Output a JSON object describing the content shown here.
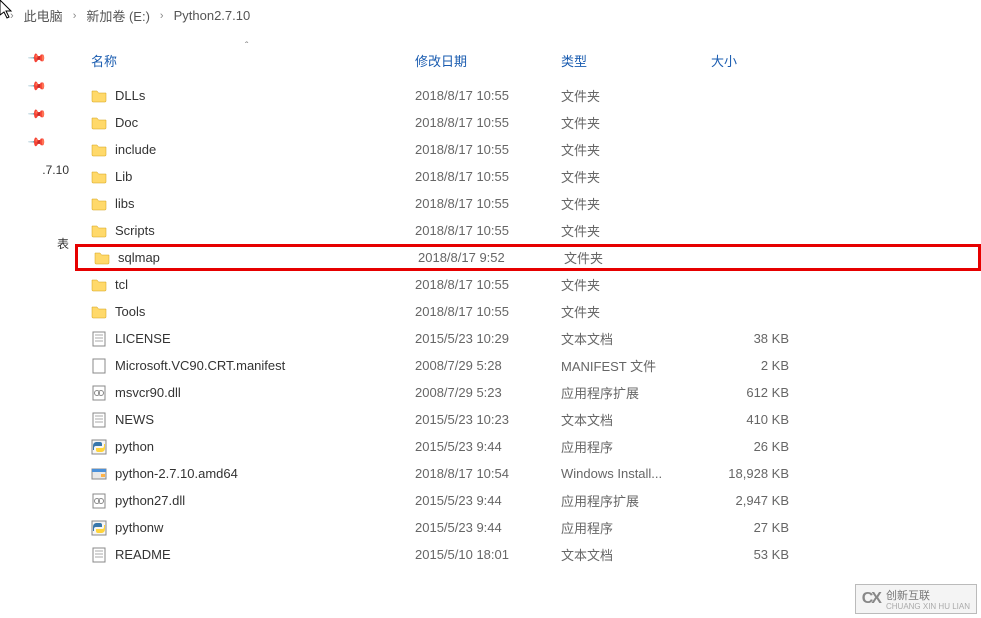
{
  "breadcrumb": {
    "items": [
      "此电脑",
      "新加卷 (E:)",
      "Python2.7.10"
    ]
  },
  "columns": {
    "name": "名称",
    "date": "修改日期",
    "type": "类型",
    "size": "大小"
  },
  "sidebar": {
    "truncated1": ".7.10",
    "truncated2": "表"
  },
  "files": [
    {
      "name": "DLLs",
      "date": "2018/8/17 10:55",
      "type": "文件夹",
      "size": "",
      "icon": "folder",
      "highlight": false
    },
    {
      "name": "Doc",
      "date": "2018/8/17 10:55",
      "type": "文件夹",
      "size": "",
      "icon": "folder",
      "highlight": false
    },
    {
      "name": "include",
      "date": "2018/8/17 10:55",
      "type": "文件夹",
      "size": "",
      "icon": "folder",
      "highlight": false
    },
    {
      "name": "Lib",
      "date": "2018/8/17 10:55",
      "type": "文件夹",
      "size": "",
      "icon": "folder",
      "highlight": false
    },
    {
      "name": "libs",
      "date": "2018/8/17 10:55",
      "type": "文件夹",
      "size": "",
      "icon": "folder",
      "highlight": false
    },
    {
      "name": "Scripts",
      "date": "2018/8/17 10:55",
      "type": "文件夹",
      "size": "",
      "icon": "folder",
      "highlight": false
    },
    {
      "name": "sqlmap",
      "date": "2018/8/17 9:52",
      "type": "文件夹",
      "size": "",
      "icon": "folder",
      "highlight": true
    },
    {
      "name": "tcl",
      "date": "2018/8/17 10:55",
      "type": "文件夹",
      "size": "",
      "icon": "folder",
      "highlight": false
    },
    {
      "name": "Tools",
      "date": "2018/8/17 10:55",
      "type": "文件夹",
      "size": "",
      "icon": "folder",
      "highlight": false
    },
    {
      "name": "LICENSE",
      "date": "2015/5/23 10:29",
      "type": "文本文档",
      "size": "38 KB",
      "icon": "text",
      "highlight": false
    },
    {
      "name": "Microsoft.VC90.CRT.manifest",
      "date": "2008/7/29 5:28",
      "type": "MANIFEST 文件",
      "size": "2 KB",
      "icon": "file",
      "highlight": false
    },
    {
      "name": "msvcr90.dll",
      "date": "2008/7/29 5:23",
      "type": "应用程序扩展",
      "size": "612 KB",
      "icon": "dll",
      "highlight": false
    },
    {
      "name": "NEWS",
      "date": "2015/5/23 10:23",
      "type": "文本文档",
      "size": "410 KB",
      "icon": "text",
      "highlight": false
    },
    {
      "name": "python",
      "date": "2015/5/23 9:44",
      "type": "应用程序",
      "size": "26 KB",
      "icon": "python",
      "highlight": false
    },
    {
      "name": "python-2.7.10.amd64",
      "date": "2018/8/17 10:54",
      "type": "Windows Install...",
      "size": "18,928 KB",
      "icon": "installer",
      "highlight": false
    },
    {
      "name": "python27.dll",
      "date": "2015/5/23 9:44",
      "type": "应用程序扩展",
      "size": "2,947 KB",
      "icon": "dll",
      "highlight": false
    },
    {
      "name": "pythonw",
      "date": "2015/5/23 9:44",
      "type": "应用程序",
      "size": "27 KB",
      "icon": "python",
      "highlight": false
    },
    {
      "name": "README",
      "date": "2015/5/10 18:01",
      "type": "文本文档",
      "size": "53 KB",
      "icon": "text",
      "highlight": false
    }
  ],
  "watermark": {
    "logo": "CX",
    "line1": "创新互联",
    "line2": "CHUANG XIN HU LIAN"
  }
}
